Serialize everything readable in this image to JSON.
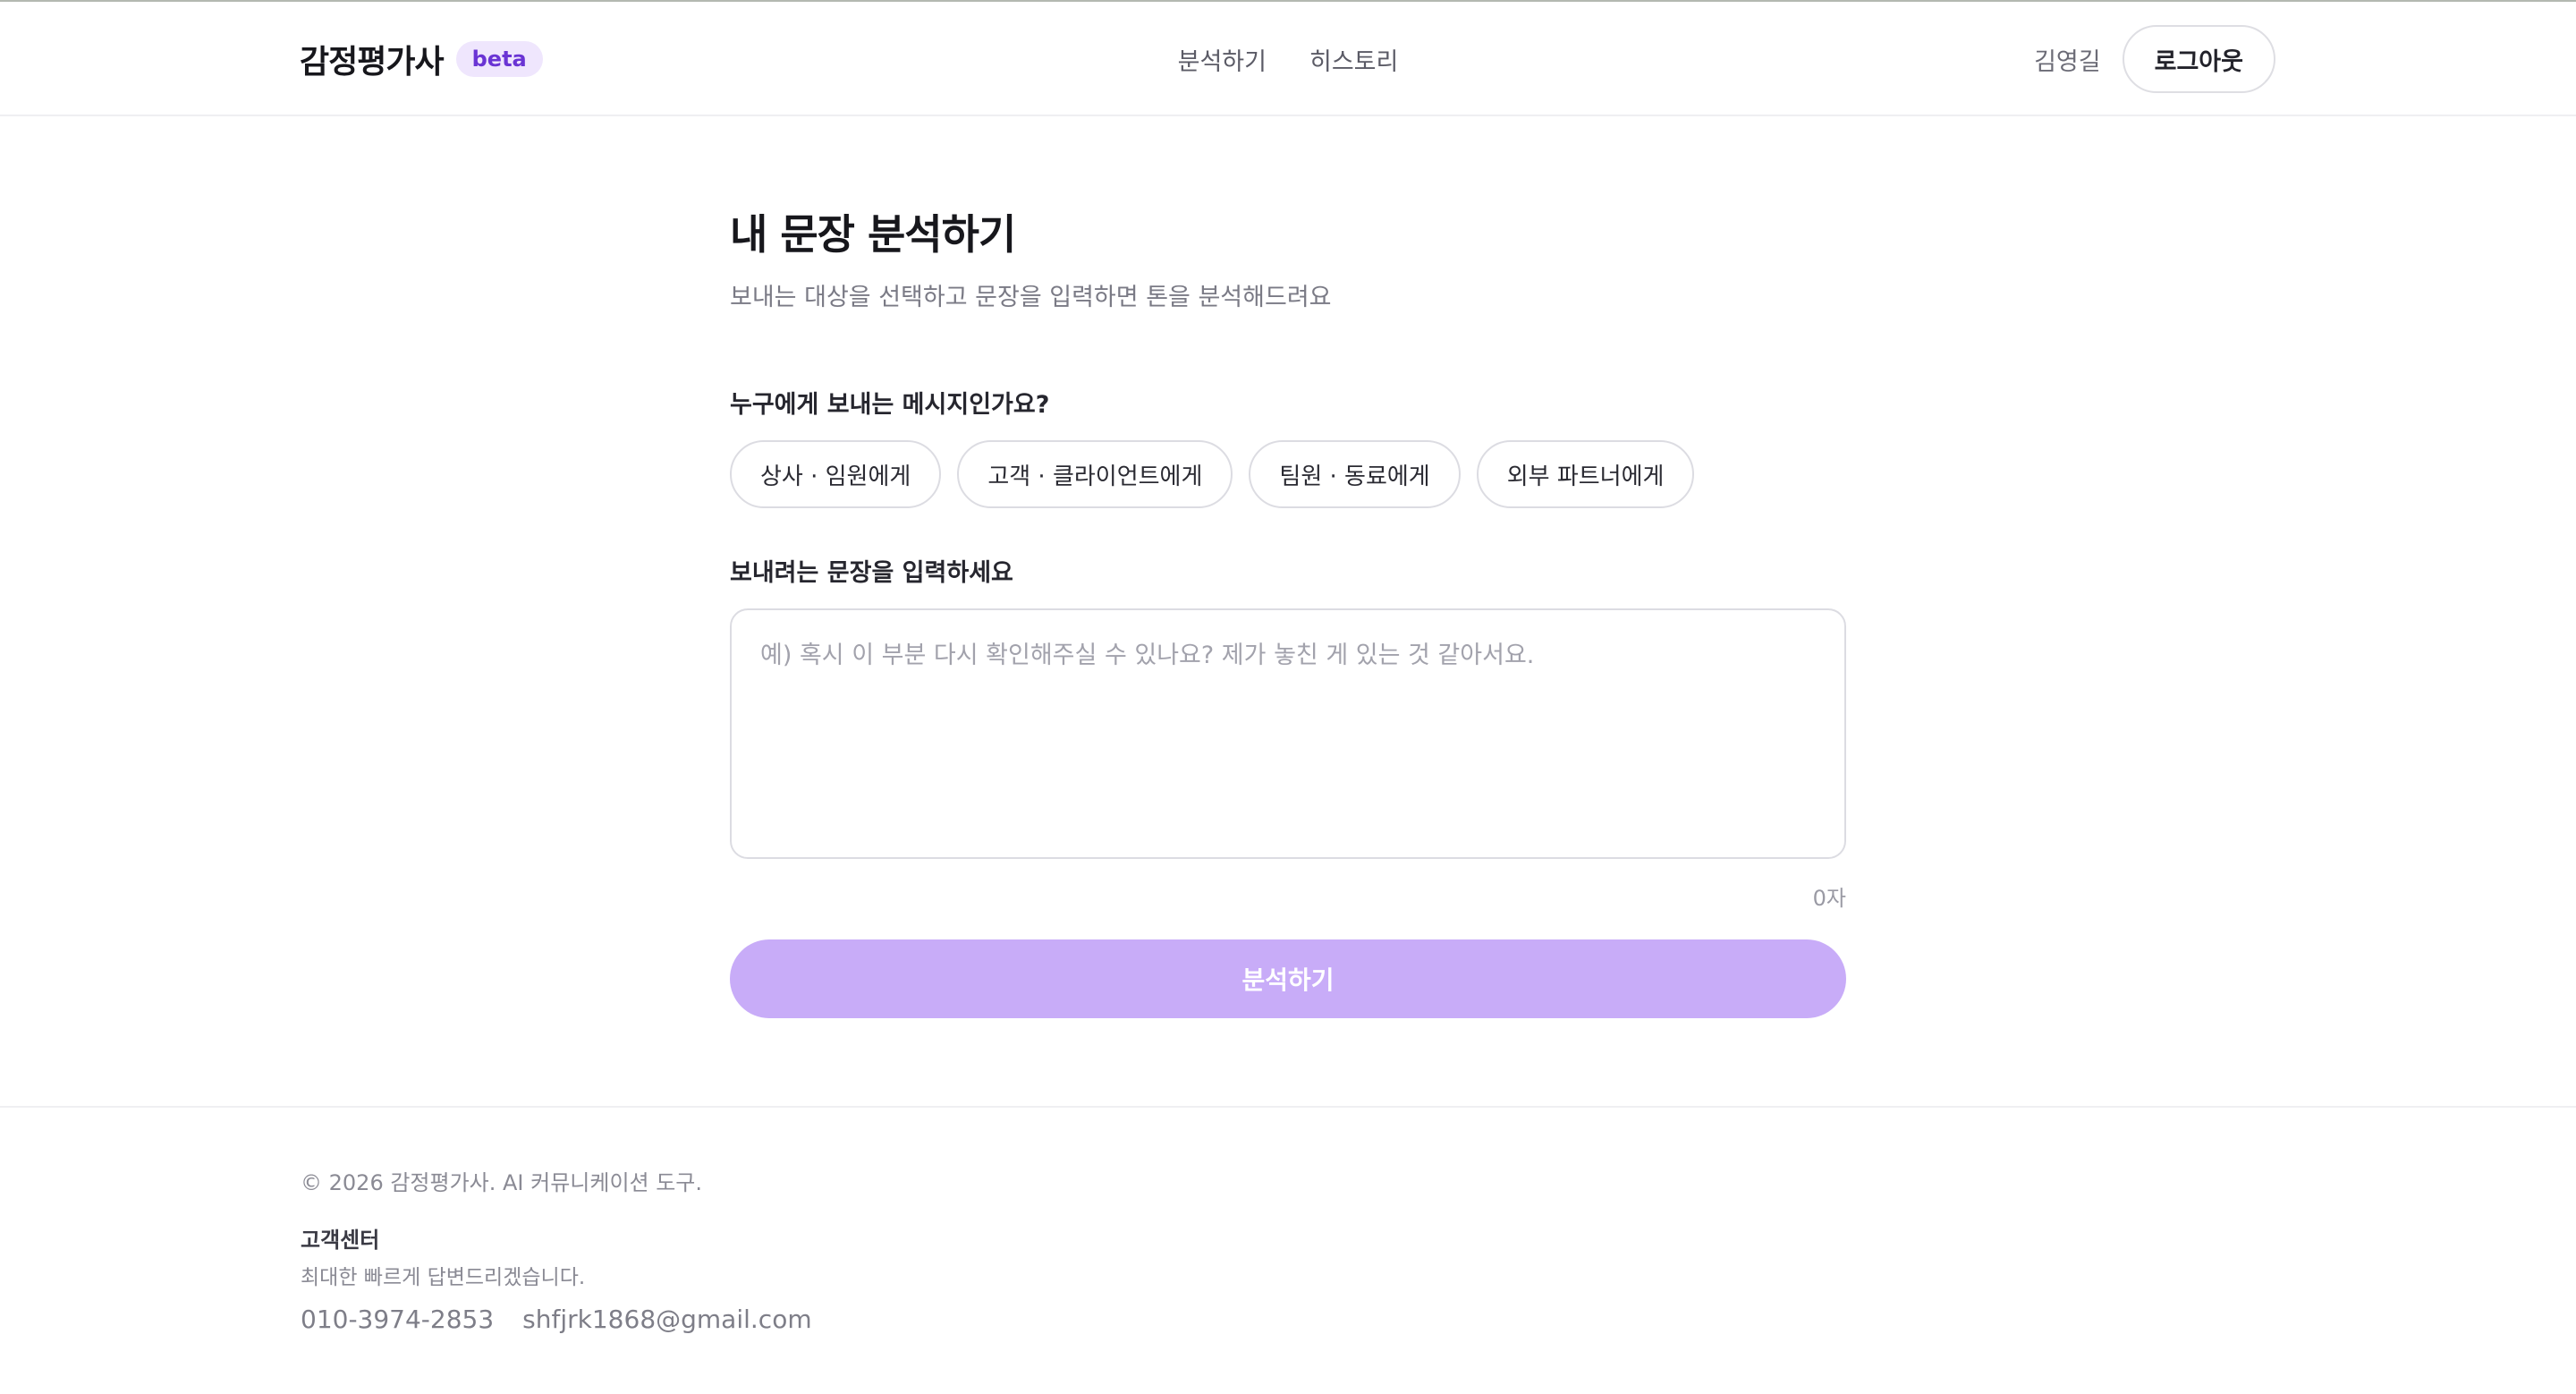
{
  "header": {
    "brand": "감정평가사",
    "badge": "beta",
    "nav": [
      "분석하기",
      "히스토리"
    ],
    "user_name": "김영길",
    "logout_label": "로그아웃"
  },
  "main": {
    "title": "내 문장 분석하기",
    "subtitle": "보내는 대상을 선택하고 문장을 입력하면 톤을 분석해드려요",
    "recipient_label": "누구에게 보내는 메시지인가요?",
    "recipients": [
      "상사 · 임원에게",
      "고객 · 클라이언트에게",
      "팀원 · 동료에게",
      "외부 파트너에게"
    ],
    "input_label": "보내려는 문장을 입력하세요",
    "input_value": "",
    "input_placeholder": "예) 혹시 이 부분 다시 확인해주실 수 있나요? 제가 놓친 게 있는 것 같아서요.",
    "char_count": "0자",
    "submit_label": "분석하기"
  },
  "footer": {
    "copyright": "© 2026 감정평가사. AI 커뮤니케이션 도구.",
    "cs_title": "고객센터",
    "cs_desc": "최대한 빠르게 답변드리겠습니다.",
    "phone": "010-3974-2853",
    "email": "shfjrk1868@gmail.com"
  },
  "colors": {
    "accent": "#c8acf8",
    "badge_bg": "#efe6fd",
    "badge_text": "#6a34d4"
  }
}
